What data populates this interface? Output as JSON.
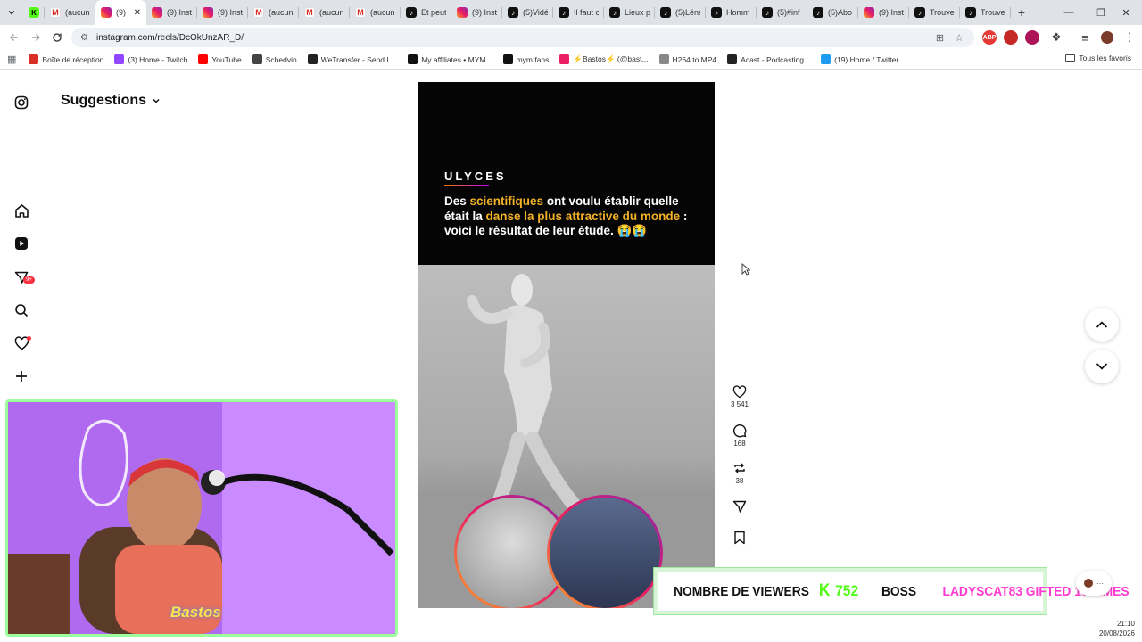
{
  "browser": {
    "tabs": [
      {
        "label": "",
        "favicon": "kick"
      },
      {
        "label": "(aucun",
        "favicon": "gmail"
      },
      {
        "label": "(9)",
        "favicon": "instagram",
        "active": true
      },
      {
        "label": "(9) Inst",
        "favicon": "instagram"
      },
      {
        "label": "(9) Inst",
        "favicon": "instagram"
      },
      {
        "label": "(aucun",
        "favicon": "gmail"
      },
      {
        "label": "(aucun",
        "favicon": "gmail"
      },
      {
        "label": "(aucun",
        "favicon": "gmail"
      },
      {
        "label": "Et peut",
        "favicon": "tiktok"
      },
      {
        "label": "(9) Inst",
        "favicon": "instagram"
      },
      {
        "label": "(5)Vidé",
        "favicon": "tiktok"
      },
      {
        "label": "Il faut c",
        "favicon": "tiktok"
      },
      {
        "label": "Lieux p",
        "favicon": "tiktok"
      },
      {
        "label": "(5)Léna",
        "favicon": "tiktok"
      },
      {
        "label": "Homm",
        "favicon": "tiktok"
      },
      {
        "label": "(5)#inf",
        "favicon": "tiktok"
      },
      {
        "label": "(5)Abo",
        "favicon": "tiktok"
      },
      {
        "label": "(9) Inst",
        "favicon": "instagram"
      },
      {
        "label": "Trouve",
        "favicon": "tiktok"
      },
      {
        "label": "Trouve",
        "favicon": "tiktok"
      }
    ],
    "url": "instagram.com/reels/DcOkUnzAR_D/",
    "bookmarks": [
      {
        "label": "Boîte de réception",
        "color": "#d93025"
      },
      {
        "label": "(3) Home - Twitch",
        "color": "#9146ff"
      },
      {
        "label": "YouTube",
        "color": "#ff0000"
      },
      {
        "label": "Schedvin",
        "color": "#444444"
      },
      {
        "label": "WeTransfer - Send L...",
        "color": "#222222"
      },
      {
        "label": "My affiliates • MYM...",
        "color": "#111111"
      },
      {
        "label": "mym.fans",
        "color": "#111111"
      },
      {
        "label": "⚡Bastos⚡ (@bast...",
        "color": "#e91e63"
      },
      {
        "label": "H264 to MP4",
        "color": "#888888"
      },
      {
        "label": "Acast - Podcasting...",
        "color": "#222222"
      },
      {
        "label": "(19) Home / Twitter",
        "color": "#1d9bf0"
      }
    ],
    "all_bookmarks_label": "Tous les favoris",
    "extensions": [
      {
        "label": "ABP",
        "color": "#e53935"
      },
      {
        "label": "",
        "color": "#c62828"
      },
      {
        "label": "",
        "color": "#ad1457"
      }
    ]
  },
  "instagram": {
    "suggestions_label": "Suggestions",
    "notifications_badge": "9+",
    "reel": {
      "brand": "ULYCES",
      "caption_parts": [
        {
          "text": "Des ",
          "hl": false
        },
        {
          "text": "scientifiques",
          "hl": true
        },
        {
          "text": " ont voulu établir quelle était la ",
          "hl": false
        },
        {
          "text": "danse la plus attractive du monde",
          "hl": true
        },
        {
          "text": " : voici le résultat de leur étude. 😭😭",
          "hl": false
        }
      ]
    },
    "actions": {
      "likes": "3 541",
      "comments": "168",
      "reposts": "38"
    }
  },
  "overlay": {
    "streamer_logo": "Bastos",
    "viewers_label": "NOMBRE DE VIEWERS",
    "viewers_icon": "K",
    "viewers_count": "752",
    "boss_label": "BOSS",
    "gift_text": "LADYSCAT83 GIFTED 10 TIMES",
    "accent_green": "#53fc18",
    "accent_pink": "#ff3ad0"
  },
  "clock": {
    "time": "21:10",
    "date": "20/08/2026"
  }
}
